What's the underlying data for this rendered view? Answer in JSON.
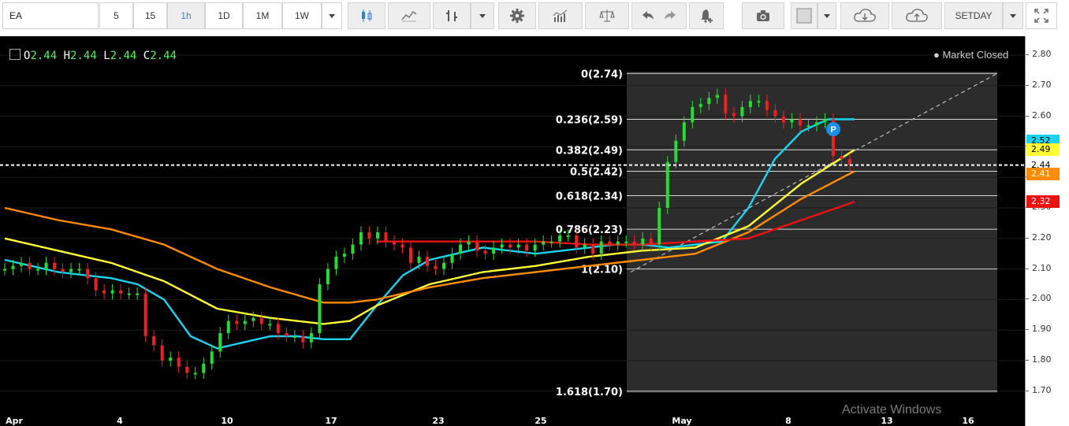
{
  "toolbar": {
    "symbol": "EA",
    "intervals": [
      "5",
      "15",
      "1h",
      "1D",
      "1M",
      "1W"
    ],
    "selected_interval": "1h",
    "setday_label": "SETDAY",
    "icons": [
      "dropdown-icon",
      "candlestick-icon",
      "line-chart-icon",
      "bar-chart-icon",
      "dropdown-icon",
      "settings-gear-icon",
      "indicators-icon",
      "compare-scale-icon",
      "undo-icon",
      "redo-icon",
      "add-alert-icon",
      "camera-icon",
      "color-box-icon",
      "dropdown-icon",
      "cloud-download-icon",
      "cloud-upload-icon",
      "dropdown-icon",
      "fullscreen-icon"
    ]
  },
  "ohlc": {
    "o_label": "O",
    "o": "2.44",
    "h_label": "H",
    "h": "2.44",
    "l_label": "L",
    "l": "2.44",
    "c_label": "C",
    "c": "2.44"
  },
  "market_status": "Market Closed",
  "chart_data": {
    "type": "candlestick",
    "symbol": "EA",
    "interval": "1h",
    "ylim": [
      1.65,
      2.84
    ],
    "y_ticks": [
      2.8,
      2.7,
      2.6,
      2.5,
      2.4,
      2.3,
      2.2,
      2.1,
      2.0,
      1.9,
      1.8,
      1.7
    ],
    "x_ticks": [
      "Apr",
      "4",
      "10",
      "17",
      "23",
      "25",
      "May",
      "8",
      "13",
      "16"
    ],
    "last_price": 2.44,
    "price_tags": [
      {
        "value": "2.52",
        "color": "#19d3f0",
        "text_color": "#000000"
      },
      {
        "value": "2.49",
        "color": "#ffff33",
        "text_color": "#000000"
      },
      {
        "value": "2.44",
        "color": "#ffffff",
        "text_color": "#000000"
      },
      {
        "value": "2.41",
        "color": "#ff8c00",
        "text_color": "#ffffff"
      },
      {
        "value": "2.32",
        "color": "#ee1111",
        "text_color": "#ffffff"
      }
    ],
    "fibonacci": {
      "levels": [
        {
          "ratio": "0",
          "price": 2.74,
          "label": "0(2.74)"
        },
        {
          "ratio": "0.236",
          "price": 2.59,
          "label": "0.236(2.59)"
        },
        {
          "ratio": "0.382",
          "price": 2.49,
          "label": "0.382(2.49)"
        },
        {
          "ratio": "0.5",
          "price": 2.42,
          "label": "0.5(2.42)"
        },
        {
          "ratio": "0.618",
          "price": 2.34,
          "label": "0.618(2.34)"
        },
        {
          "ratio": "0.786",
          "price": 2.23,
          "label": "0.786(2.23)"
        },
        {
          "ratio": "1",
          "price": 2.1,
          "label": "1(2.10)"
        },
        {
          "ratio": "1.618",
          "price": 1.7,
          "label": "1.618(1.70)"
        }
      ]
    },
    "moving_averages": [
      {
        "color": "#19d3f0",
        "x": [
          0,
          5,
          10,
          15,
          20,
          25,
          30,
          35,
          40,
          45,
          50,
          55,
          60,
          65,
          70,
          75,
          80,
          85,
          90,
          95,
          100,
          105,
          110,
          115,
          120,
          125,
          130,
          135,
          140,
          145,
          150,
          155,
          160
        ],
        "y": [
          2.13,
          2.11,
          2.09,
          2.08,
          2.07,
          2.05,
          2.0,
          1.88,
          1.84,
          1.86,
          1.88,
          1.88,
          1.87,
          1.87,
          1.98,
          2.08,
          2.13,
          2.15,
          2.17,
          2.16,
          2.15,
          2.16,
          2.17,
          2.18,
          2.18,
          2.17,
          2.18,
          2.19,
          2.3,
          2.46,
          2.55,
          2.59,
          2.59
        ]
      },
      {
        "color": "#ffff33",
        "x": [
          0,
          10,
          20,
          30,
          40,
          50,
          60,
          65,
          70,
          80,
          90,
          100,
          110,
          120,
          130,
          140,
          150,
          160
        ],
        "y": [
          2.2,
          2.16,
          2.12,
          2.06,
          1.97,
          1.94,
          1.92,
          1.93,
          1.98,
          2.05,
          2.09,
          2.11,
          2.14,
          2.16,
          2.17,
          2.24,
          2.38,
          2.49
        ]
      },
      {
        "color": "#ff8c00",
        "x": [
          0,
          10,
          20,
          30,
          40,
          50,
          60,
          65,
          70,
          80,
          90,
          100,
          110,
          120,
          130,
          140,
          150,
          160
        ],
        "y": [
          2.3,
          2.26,
          2.23,
          2.18,
          2.1,
          2.04,
          1.99,
          1.99,
          2.0,
          2.04,
          2.07,
          2.09,
          2.11,
          2.13,
          2.15,
          2.22,
          2.33,
          2.42
        ]
      },
      {
        "color": "#ee1111",
        "x": [
          0,
          10,
          20,
          30,
          40,
          50,
          60,
          65,
          70,
          80,
          90,
          100,
          110,
          120,
          130,
          140,
          150,
          160
        ],
        "y": [
          null,
          null,
          null,
          null,
          null,
          null,
          null,
          null,
          2.19,
          2.19,
          2.19,
          2.19,
          2.18,
          2.18,
          2.19,
          2.2,
          2.26,
          2.32
        ]
      }
    ],
    "candles_close": [
      2.1,
      2.11,
      2.12,
      2.1,
      2.1,
      2.12,
      2.1,
      2.09,
      2.1,
      2.1,
      2.07,
      2.03,
      2.02,
      2.03,
      2.02,
      2.02,
      2.02,
      1.88,
      1.85,
      1.8,
      1.81,
      1.78,
      1.76,
      1.76,
      1.79,
      1.83,
      1.89,
      1.93,
      1.92,
      1.93,
      1.94,
      1.92,
      1.92,
      1.89,
      1.88,
      1.88,
      1.86,
      1.89,
      2.05,
      2.1,
      2.14,
      2.15,
      2.18,
      2.22,
      2.2,
      2.22,
      2.19,
      2.18,
      2.17,
      2.12,
      2.14,
      2.11,
      2.1,
      2.12,
      2.15,
      2.18,
      2.19,
      2.16,
      2.15,
      2.17,
      2.18,
      2.17,
      2.18,
      2.16,
      2.18,
      2.19,
      2.19,
      2.21,
      2.21,
      2.17,
      2.18,
      2.15,
      2.19,
      2.18,
      2.19,
      2.19,
      2.18,
      2.2,
      2.18,
      2.3,
      2.45,
      2.52,
      2.58,
      2.63,
      2.64,
      2.66,
      2.67,
      2.61,
      2.6,
      2.63,
      2.65,
      2.65,
      2.62,
      2.6,
      2.58,
      2.59,
      2.57,
      2.57,
      2.58,
      2.59,
      2.47,
      2.46,
      2.44
    ]
  },
  "watermark": "Activate Windows"
}
